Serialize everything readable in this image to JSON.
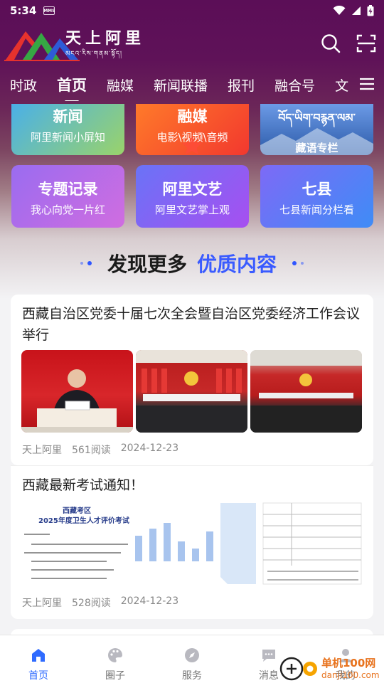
{
  "status_bar": {
    "time": "5:34",
    "chip": "MMS"
  },
  "app": {
    "logo_text_cn": "天上阿里",
    "logo_text_tibetan": "མངའ་རིས་གནམ་སྟོད།"
  },
  "channel_tabs": [
    "时政",
    "首页",
    "融媒",
    "新闻联播",
    "报刊",
    "融合号",
    "文"
  ],
  "active_tab_index": 1,
  "grid_cards": [
    {
      "title": "新闻",
      "subtitle": "阿里新闻小屏知",
      "color_from": "#4ab0e8",
      "color_to": "#9ad36a"
    },
    {
      "title": "融媒",
      "subtitle": "电影\\视频\\音频",
      "color_from": "#ff7a2a",
      "color_to": "#f2382e"
    },
    {
      "title": "བོད་ཡིག་བརྙན་ལམ་",
      "subtitle": "藏语专栏",
      "color_from": "#5b8fe0",
      "color_to": "#2b5aa8"
    },
    {
      "title": "专题记录",
      "subtitle": "我心向党一片红",
      "color_from": "#9a6cf0",
      "color_to": "#d06de0"
    },
    {
      "title": "阿里文艺",
      "subtitle": "阿里文艺掌上观",
      "color_from": "#6a73f7",
      "color_to": "#a74ff0"
    },
    {
      "title": "七县",
      "subtitle": "七县新闻分栏看",
      "color_from": "#7d6af6",
      "color_to": "#3f8cf6"
    }
  ],
  "discover": {
    "dark_text": "发现更多",
    "blue_text": "优质内容"
  },
  "news": [
    {
      "title": "西藏自治区党委十届七次全会暨自治区党委经济工作会议举行",
      "source": "天上阿里",
      "reads": "561阅读",
      "date": "2024-12-23"
    },
    {
      "title": "西藏最新考试通知！",
      "source": "天上阿里",
      "reads": "528阅读",
      "date": "2024-12-23",
      "doc_header": "西藏考区",
      "doc_subheader": "2025年度卫生人才评价考试"
    }
  ],
  "bottom_tabs": [
    {
      "label": "首页",
      "icon": "home-icon"
    },
    {
      "label": "圈子",
      "icon": "palette-icon"
    },
    {
      "label": "服务",
      "icon": "compass-icon"
    },
    {
      "label": "消息",
      "icon": "chat-icon"
    },
    {
      "label": "我的",
      "icon": "user-icon"
    }
  ],
  "active_bottom_tab": 0,
  "watermark": {
    "line1": "单机100网",
    "line2": "danji100.com"
  },
  "colors": {
    "accent": "#2f6bff",
    "header": "#5b0e57",
    "discover_blue": "#3a5bff"
  }
}
